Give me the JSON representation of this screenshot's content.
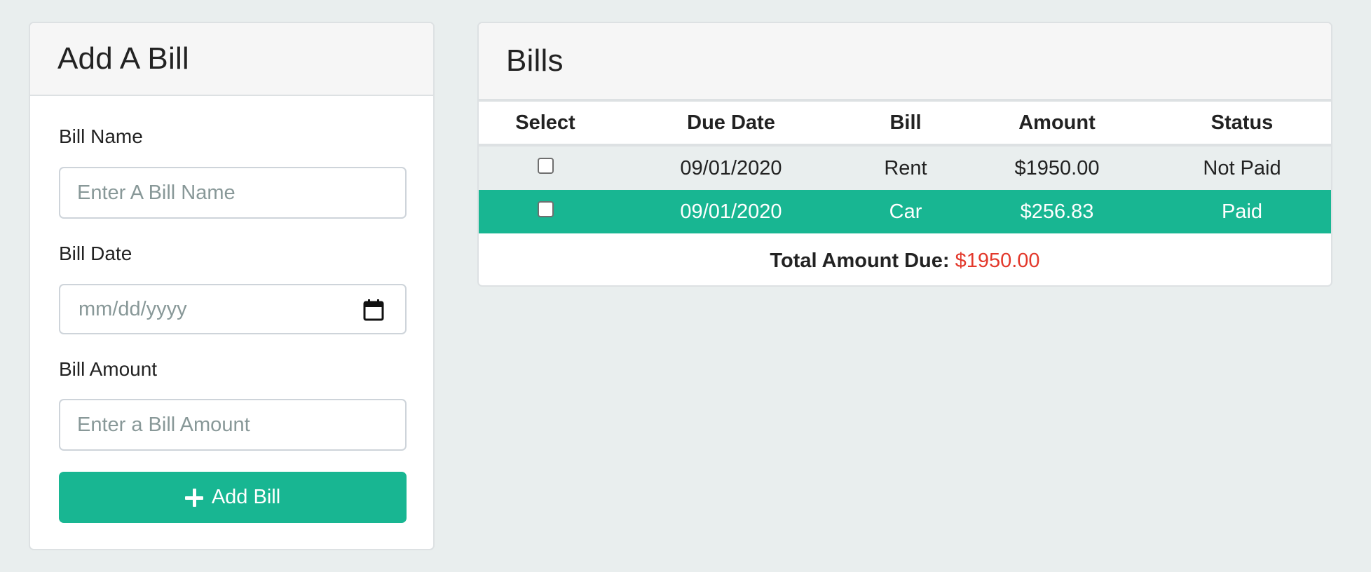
{
  "add_bill": {
    "title": "Add A Bill",
    "name_label": "Bill Name",
    "name_placeholder": "Enter A Bill Name",
    "date_label": "Bill Date",
    "date_placeholder": "mm/dd/yyyy",
    "amount_label": "Bill Amount",
    "amount_placeholder": "Enter a Bill Amount",
    "button_label": "Add Bill",
    "button_icon": "plus-icon"
  },
  "bills": {
    "title": "Bills",
    "columns": [
      "Select",
      "Due Date",
      "Bill",
      "Amount",
      "Status"
    ],
    "rows": [
      {
        "checked": false,
        "due_date": "09/01/2020",
        "bill": "Rent",
        "amount": "$1950.00",
        "status": "Not Paid"
      },
      {
        "checked": false,
        "due_date": "09/01/2020",
        "bill": "Car",
        "amount": "$256.83",
        "status": "Paid"
      }
    ],
    "total_label": "Total Amount Due:",
    "total_value": "$1950.00"
  },
  "colors": {
    "background": "#e9eeee",
    "accent_green": "#18b692",
    "total_red": "#e3392c"
  }
}
